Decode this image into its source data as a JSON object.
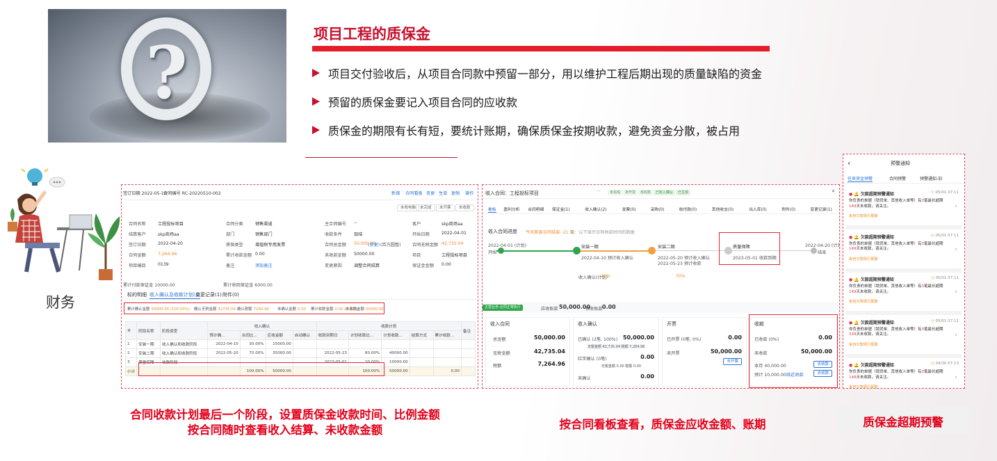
{
  "slide": {
    "title": "项目工程的质保金",
    "bullets": [
      "项目交付验收后，从项目合同款中预留一部分，用以维护工程后期出现的质量缺陷的资金",
      "预留的质保金要记入项目合同的应收款",
      "质保金的期限有长有短，要统计账期，确保质保金按期收款，避免资金分散，被占用"
    ],
    "finance_label": "财务",
    "captions": {
      "left_line1": "合同收款计划最后一个阶段，设置质保金收款时间、比例金额",
      "left_line2": "按合同随时查看收入结算、未收款金额",
      "middle": "按合同看板查看，质保金应收金额、账期",
      "right": "质保金超期预警"
    },
    "accent_color": "#e3001b"
  },
  "contract_panel": {
    "header_date": "签订日期  2022-05-10",
    "header_no": "合同编号   RC-20220510-002",
    "actions": [
      "新增",
      "合同看板",
      "变更",
      "生单",
      "复制",
      "操作"
    ],
    "sub_actions": [
      "未收电脑",
      "未完成",
      "未开票",
      "未收款"
    ],
    "fields_left": [
      [
        "合同名称",
        "工程投标项目"
      ],
      [
        "结算客户",
        "skp商场aa"
      ],
      [
        "签订日期",
        "2022-04-20"
      ],
      [
        "合同金额",
        "7,264.96"
      ],
      [
        "项目编目",
        "0139"
      ]
    ],
    "fields_mid": [
      [
        "合同分类",
        "销售渠道"
      ],
      [
        "部门",
        "销售部门"
      ],
      [
        "质保类型",
        "增值税专用发票"
      ],
      [
        "累计收款金额",
        "0.00"
      ],
      [
        "备注",
        "添加备注"
      ]
    ],
    "fields_right": [
      [
        "主合同编号",
        "--"
      ],
      [
        "收款条件",
        "现结"
      ],
      [
        "合同总金额",
        "50,000.00"
      ],
      [
        "未收款金额",
        "50000.00"
      ],
      [
        "变更原因",
        "调整合同结算"
      ]
    ],
    "fields_far": [
      [
        "客户",
        "skp商场aa"
      ],
      [
        "开始日期",
        "2022-04-01"
      ],
      [
        "合同无税金额",
        "42,735.04"
      ],
      [
        "项目",
        "工程投标项目"
      ],
      [
        "保证金金额",
        "0.00"
      ]
    ],
    "change_link": "(变更)",
    "cap_note": "(百万圆整)",
    "accum_invoice": "累计付款保证金  10000.00",
    "accum_received": "累计收回保证金  6000.00",
    "tabs": [
      "标的明细",
      "收入确认及收款计划(3)",
      "变更记录(1)",
      "附件(0)"
    ],
    "summary": [
      [
        "累计确认金额",
        "50000.00 (100.00%)"
      ],
      [
        "确认无税金额",
        "42735.04"
      ],
      [
        "确认税额",
        "7264.96"
      ],
      [
        "未确认金额",
        "0.00"
      ],
      [
        "累计收款金额",
        "0.00 (0.00%)"
      ],
      [
        "未收款金额",
        "50000.00"
      ]
    ],
    "table_group_headers": [
      "收入确认",
      "收款计划"
    ],
    "table_headers": [
      "",
      "阶段名称",
      "阶段类型",
      "预计确...",
      "合同比...",
      "应收金额",
      "自动确认",
      "收款到期日",
      "计划收款比...",
      "计划收款...",
      "结算方式",
      "累计收款...",
      "备注"
    ],
    "rows": [
      [
        "1",
        "安装一期",
        "收入确认和收款阶段",
        "2022-04-10",
        "30.00%",
        "15000.00",
        "",
        "",
        "",
        "",
        "",
        "",
        ""
      ],
      [
        "2",
        "安装二期",
        "收入确认和收款阶段",
        "2022-05-20",
        "70.00%",
        "35000.00",
        "",
        "2022-05-23",
        "80.00%",
        "40000.00",
        "",
        "",
        ""
      ],
      [
        "3",
        "质量保障",
        "收款阶段",
        "",
        "",
        "",
        "",
        "2023-05-01",
        "20.00%",
        "10000.00",
        "",
        "",
        ""
      ]
    ],
    "total_row": [
      "小计",
      "",
      "",
      "",
      "100.00%",
      "50000.00",
      "",
      "",
      "100.00%",
      "50000.00",
      "",
      "0.00",
      ""
    ]
  },
  "board_panel": {
    "title": "收入合同：工程投标项目",
    "tags": [
      "未完成",
      "未开票",
      "未收款",
      "已收入确认",
      "已生效"
    ],
    "nav": [
      "看板",
      "盈利分析",
      "合同明细",
      "保证金(1)",
      "收入确认(2)",
      "发票(0)",
      "采购(0)",
      "收付款(0)",
      "其他收支(0)",
      "出入库(0)",
      "附件(0)",
      "变更记录(1)"
    ],
    "progress_title": "收入合同进度",
    "progress_warn": "今天距离合同结束 -21 天",
    "progress_note": "说：以下显示合同收款时间的数据",
    "start_label": "2022-04-01 (计划)",
    "start_text": "开始",
    "end_label": "2022-04-20 (计划)",
    "end_text": "结束",
    "steps": [
      {
        "name": "安装一期",
        "date": "2022-04-10 预计收入确认",
        "sub1": "收入确认(计划)",
        "sub2": "30%"
      },
      {
        "name": "安装二期",
        "date": "2022-05-20 预计收入确认",
        "sub1": "2022-05-23 预计收款",
        "sub2": "70%"
      },
      {
        "name": "质量保障",
        "date": "2023-05-01 收款到期",
        "sub1": "",
        "sub2": ""
      }
    ],
    "business_tag": "主营业务-合同正常执行",
    "contract_amount_label": "应收账款",
    "contract_amount": "50,000.00",
    "deposit_label": "预收账款",
    "deposit_amount": "0.00",
    "cards": {
      "income": {
        "title": "收入合同",
        "rows": [
          [
            "总金额",
            "50,000.00"
          ],
          [
            "无税金额",
            "42,735.04"
          ],
          [
            "税额",
            "7,264.96"
          ]
        ]
      },
      "confirm": {
        "title": "收入确认",
        "rows": [
          [
            "已确认 (2笔, 100%)",
            "50,000.00"
          ],
          [
            "红字确认 (0笔)",
            "0.00"
          ],
          [
            "未确认",
            "0.00"
          ]
        ],
        "subs": [
          "无税金额 42,735.04  税额 7,264.96",
          "无税金额 0.00  税额 0.00"
        ]
      },
      "invoice": {
        "title": "开票",
        "rows": [
          [
            "已开票 (0笔, 0%)",
            "0.00"
          ],
          [
            "未开票",
            "50,000.00"
          ]
        ],
        "btn": "去开票"
      },
      "receipt": {
        "title": "收款",
        "rows": [
          [
            "已收款 (0%)",
            "0.00"
          ],
          [
            "未收款",
            "50,000.00"
          ]
        ],
        "subs": [
          "本月 40,000.00",
          "预计 10,000.00"
        ],
        "btn": "去收款",
        "link": "临近收款"
      }
    }
  },
  "alert_panel": {
    "title": "预警通知",
    "tabs": [
      "往来资金预警",
      "合同预警",
      "预警通知-旧"
    ],
    "items": [
      {
        "title": "欠款超期预警通知",
        "time": "05/01 07:11",
        "body_a": "你负责的单据（销货单、其他收入单等）有",
        "count": "3",
        "body_b": "笔最长超期",
        "days": "149",
        "body_c": "天未收款，请关注。",
        "link": "来自欠款周行报警"
      },
      {
        "title": "欠款超期预警通知",
        "time": "05/01 07:11",
        "body_a": "你负责的单据（销货单、其他收入单等）有",
        "count": "3",
        "body_b": "笔最长超期",
        "days": "149",
        "body_c": "天未收款，请关注。",
        "link": "来自欠款周行报警"
      },
      {
        "title": "欠款超期预警通知",
        "time": "05/01 07:11",
        "body_a": "你负责的单据（销货单、其他收入单等）有",
        "count": "3",
        "body_b": "笔最长超期",
        "days": "149",
        "body_c": "天未收款，请关注。",
        "link": "来自欠款周行报警"
      },
      {
        "title": "欠款超期预警通知",
        "time": "05/01 07:11",
        "body_a": "你负责的单据（销货单、其他收入单等）有",
        "count": "3",
        "body_b": "笔最长超期",
        "days": "328",
        "body_c": "天未收款，请关注。",
        "link": "来自欠款周行报警"
      },
      {
        "title": "欠款超期预警通知",
        "time": "04/30 07:13",
        "body_a": "你负责的单据（销货单、其他收入单等）有",
        "count": "3",
        "body_b": "笔最长超期",
        "days": "148",
        "body_c": "天未收款，请关注。",
        "link": "来自欠款周行报警"
      }
    ]
  }
}
